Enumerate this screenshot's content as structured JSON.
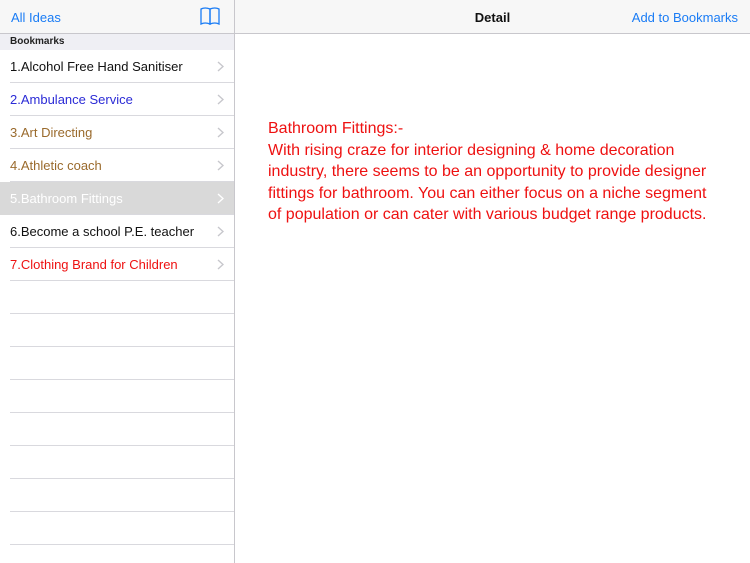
{
  "sidebar": {
    "back_label": "All Ideas",
    "section_title": "Bookmarks",
    "items": [
      {
        "label": "1.Alcohol Free Hand Sanitiser",
        "color": "#111111"
      },
      {
        "label": "2.Ambulance Service",
        "color": "#2b2bd6"
      },
      {
        "label": "3.Art Directing",
        "color": "#9a6a2c"
      },
      {
        "label": "4.Athletic coach",
        "color": "#9a6a2c"
      },
      {
        "label": "5.Bathroom Fittings",
        "color": "#ffffff",
        "selected": true
      },
      {
        "label": "6.Become a school P.E. teacher",
        "color": "#111111"
      },
      {
        "label": "7.Clothing Brand for Children",
        "color": "#ee1111"
      }
    ],
    "book_icon": "book-icon"
  },
  "detail": {
    "title": "Detail",
    "add_bookmark_label": "Add to Bookmarks",
    "heading": "Bathroom Fittings:-",
    "body": "With rising craze for interior designing & home decoration industry, there seems to be an opportunity to provide designer fittings for bathroom. You can either focus on a niche segment of population or can cater with various budget range products."
  },
  "colors": {
    "accent": "#1a7cf5",
    "detail_text": "#ee1111",
    "selected_row": "#d9d9d9"
  }
}
